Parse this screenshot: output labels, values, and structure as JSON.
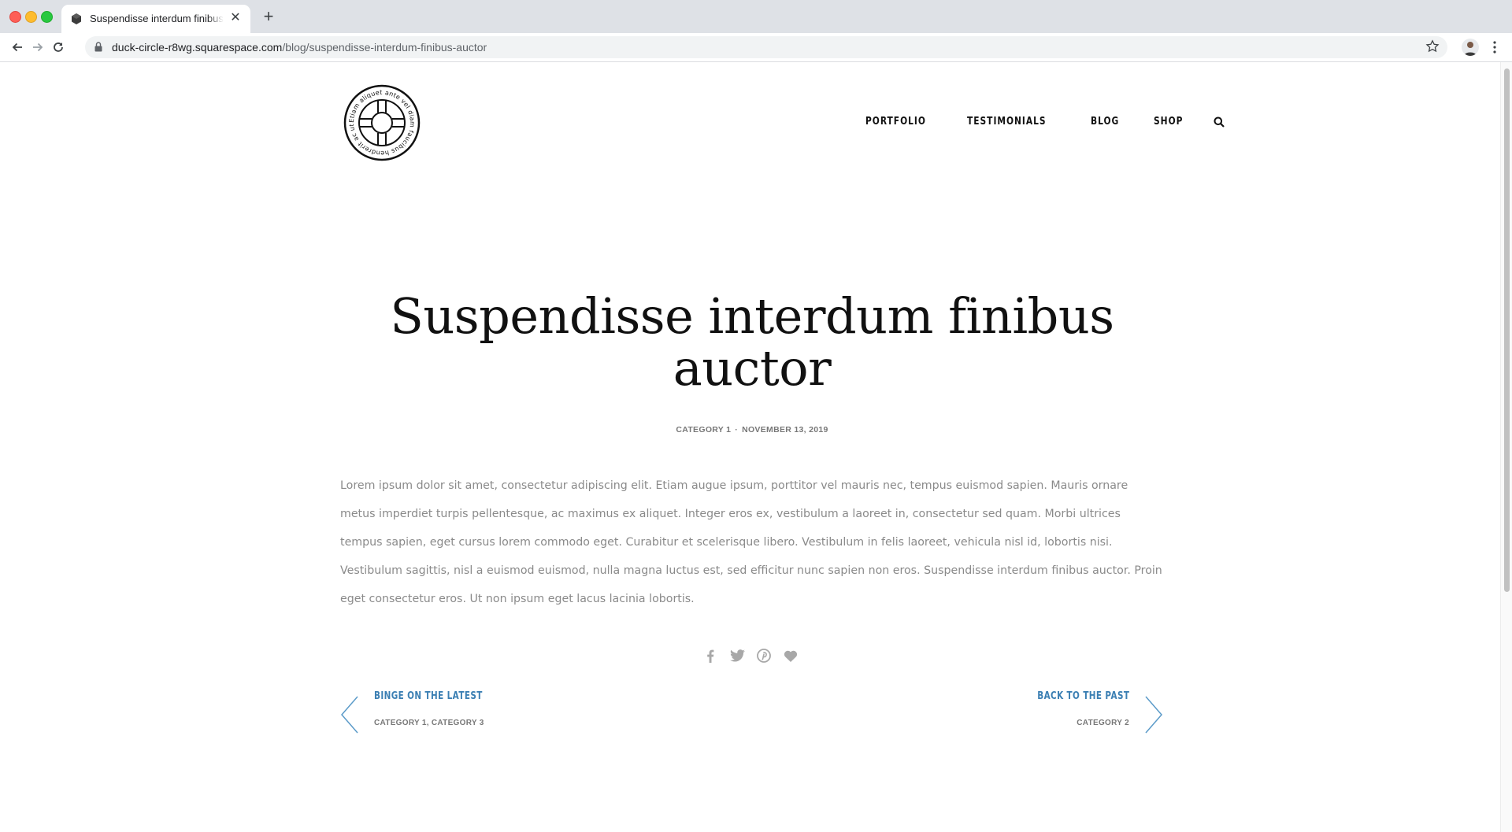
{
  "browser": {
    "tab_title": "Suspendisse interdum finibus auctor",
    "url_host": "duck-circle-r8wg.squarespace.com",
    "url_path": "/blog/suspendisse-interdum-finibus-auctor"
  },
  "site": {
    "logo_text": "Etiam aliquet ante vel diam faucibus hendrerit ac ut arcu",
    "nav": [
      "PORTFOLIO",
      "TESTIMONIALS",
      "BLOG",
      "SHOP"
    ]
  },
  "post": {
    "title": "Suspendisse interdum finibus auctor",
    "category": "CATEGORY 1",
    "date": "NOVEMBER 13, 2019",
    "body": "Lorem ipsum dolor sit amet, consectetur adipiscing elit. Etiam augue ipsum, porttitor vel mauris nec, tempus euismod sapien. Mauris ornare metus imperdiet turpis pellentesque, ac maximus ex aliquet. Integer eros ex, vestibulum a laoreet in, consectetur sed quam. Morbi ultrices tempus sapien, eget cursus lorem commodo eget. Curabitur et scelerisque libero. Vestibulum in felis laoreet, vehicula nisl id, lobortis nisi. Vestibulum sagittis, nisl a euismod euismod, nulla magna luctus est, sed efficitur nunc sapien non eros. Suspendisse interdum finibus auctor. Proin eget consectetur eros. Ut non ipsum eget lacus lacinia lobortis."
  },
  "share_icons": [
    "facebook-icon",
    "twitter-icon",
    "pinterest-icon",
    "heart-icon"
  ],
  "pagination": {
    "prev": {
      "title": "BINGE ON THE LATEST",
      "categories": "CATEGORY 1, CATEGORY 3"
    },
    "next": {
      "title": "BACK TO THE PAST",
      "categories": "CATEGORY 2"
    }
  },
  "colors": {
    "accent": "#3b7fb3",
    "text": "#111111",
    "muted": "#8a8a8a",
    "chrome": "#dee1e6"
  }
}
